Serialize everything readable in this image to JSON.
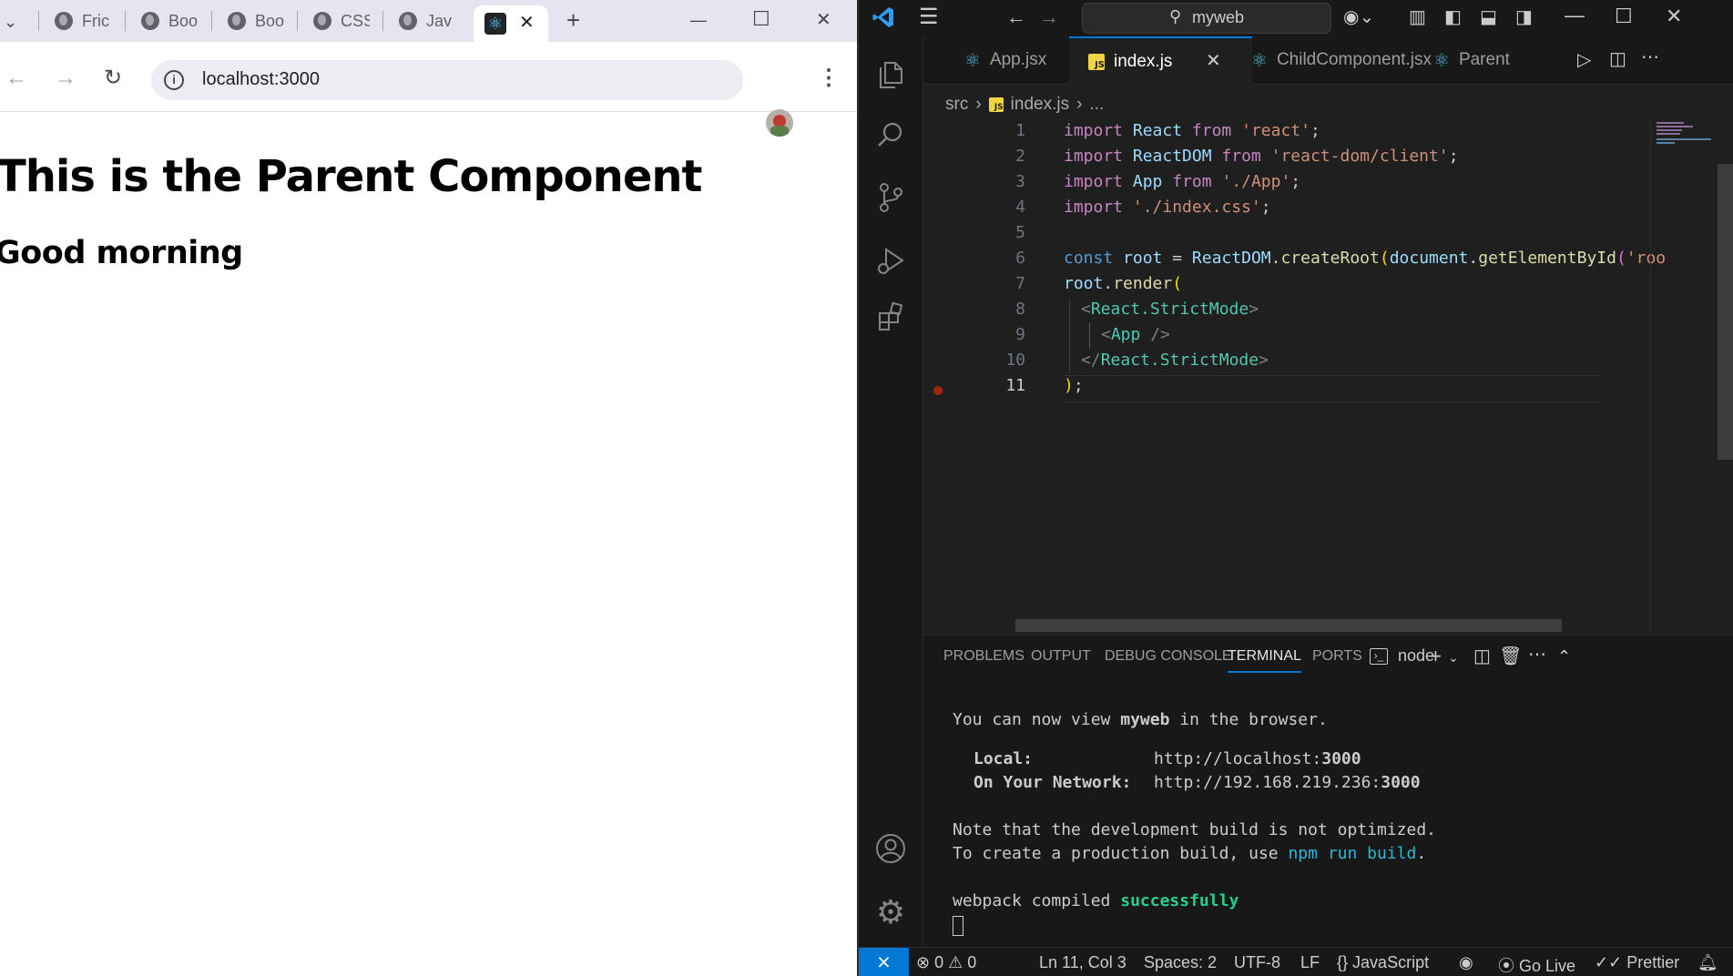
{
  "browser": {
    "tabs": [
      {
        "title": "Fric"
      },
      {
        "title": "Boo"
      },
      {
        "title": "Boo"
      },
      {
        "title": "CSS"
      },
      {
        "title": "Jav"
      }
    ],
    "active_tab_close": "✕",
    "new_tab": "+",
    "window_controls": {
      "minimize": "—",
      "maximize": "☐",
      "close": "✕"
    },
    "url": "localhost:3000",
    "page": {
      "h1": "This is the Parent Component",
      "h2": "Good morning"
    }
  },
  "vscode": {
    "search_text": "myweb",
    "editor_tabs": [
      {
        "label": "App.jsx",
        "icon": "react-icon"
      },
      {
        "label": "index.js",
        "icon": "js-file-icon",
        "active": true
      },
      {
        "label": "ChildComponent.jsx",
        "icon": "react-icon"
      },
      {
        "label": "Parent",
        "icon": "react-icon"
      }
    ],
    "breadcrumb": {
      "folder": "src",
      "file": "index.js",
      "more": "..."
    },
    "line_numbers": [
      "1",
      "2",
      "3",
      "4",
      "5",
      "6",
      "7",
      "8",
      "9",
      "10",
      "11"
    ],
    "code": {
      "l1": [
        "import",
        "React",
        "from",
        "'react'",
        ";"
      ],
      "l2": [
        "import",
        "ReactDOM",
        "from",
        "'react-dom/client'",
        ";"
      ],
      "l3": [
        "import",
        "App",
        "from",
        "'./App'",
        ";"
      ],
      "l4": [
        "import",
        "'./index.css'",
        ";"
      ],
      "l6": [
        "const",
        "root",
        "=",
        "ReactDOM",
        ".",
        "createRoot",
        "(",
        "document",
        ".",
        "getElementById",
        "(",
        "'roo"
      ],
      "l7": [
        "root",
        ".",
        "render",
        "("
      ],
      "l8": [
        "<",
        "React.StrictMode",
        ">"
      ],
      "l9": [
        "<",
        "App",
        "/>"
      ],
      "l10": [
        "</",
        "React.StrictMode",
        ">"
      ],
      "l11": [
        ")",
        ";"
      ]
    },
    "panel": {
      "tabs": [
        "PROBLEMS",
        "OUTPUT",
        "DEBUG CONSOLE",
        "TERMINAL",
        "PORTS"
      ],
      "active": "TERMINAL",
      "shell": "node",
      "terminal": {
        "line1_a": "You can now view ",
        "line1_b": "myweb",
        "line1_c": " in the browser.",
        "local_label": "Local:",
        "local_url_a": "http://localhost:",
        "local_url_b": "3000",
        "network_label": "On Your Network:",
        "network_url_a": "http://192.168.219.236:",
        "network_url_b": "3000",
        "note1": "Note that the development build is not optimized.",
        "note2_a": "To create a production build, use ",
        "note2_b": "npm run build",
        "note2_c": ".",
        "compiled_a": "webpack compiled ",
        "compiled_b": "successfully"
      }
    },
    "status": {
      "errors": "0",
      "warnings": "0",
      "position": "Ln 11, Col 3",
      "spaces": "Spaces: 2",
      "encoding": "UTF-8",
      "eol": "LF",
      "language": "JavaScript",
      "golive": "Go Live",
      "prettier": "Prettier"
    }
  }
}
